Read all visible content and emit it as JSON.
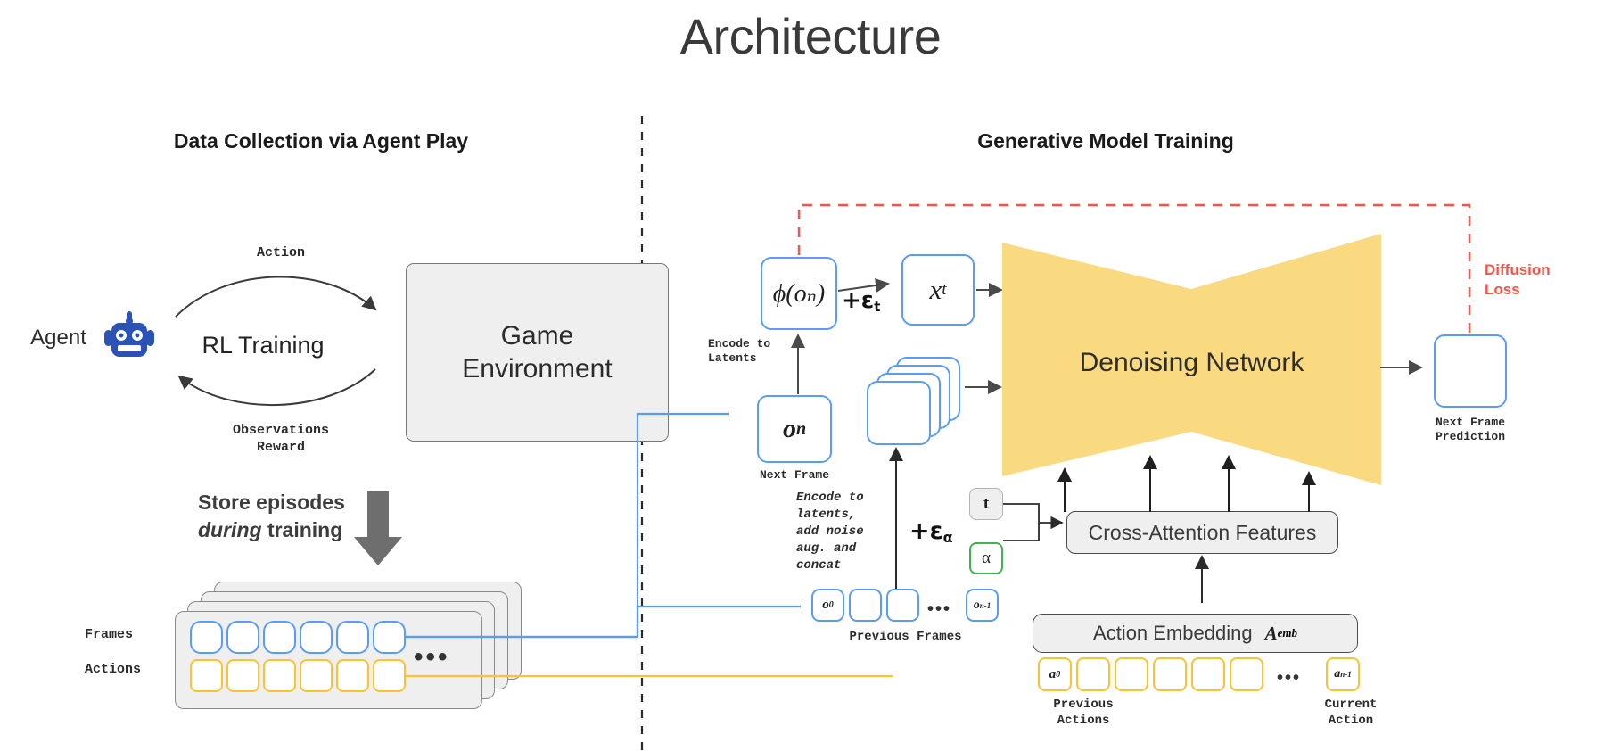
{
  "page": {
    "title": "Architecture",
    "accent_blue": "#5b9bf8",
    "accent_yellow": "#fcc230",
    "accent_red": "#f2564b",
    "network_fill": "#fada80",
    "robot_color": "#2a53b5"
  },
  "left_panel": {
    "heading": "Data Collection via Agent Play",
    "agent_label": "Agent",
    "robot_icon": "robot-icon",
    "rl_training_label": "RL Training",
    "action_label": "Action",
    "observations_reward_label": "Observations\nReward",
    "game_environment_label": "Game\nEnvironment",
    "store_episodes_line1": "Store episodes",
    "store_episodes_italic": "during",
    "store_episodes_line2": "training",
    "frames_label": "Frames",
    "actions_label": "Actions",
    "frames_count": 6,
    "actions_count": 6,
    "episode_card_count": 4,
    "ellipsis": "•••"
  },
  "right_panel": {
    "heading": "Generative Model Training",
    "phi_box_label": "ϕ(oₙ)",
    "noise_t_label": "+ε",
    "noise_t_sub": "t",
    "xt_box_label": "x",
    "xt_box_sub": "t",
    "encode_to_latents_label": "Encode to\nLatents",
    "next_frame_box_label": "o",
    "next_frame_box_sub": "n",
    "next_frame_caption": "Next Frame",
    "encode_concat_label": "Encode to\nlatents,\nadd noise\naug. and\nconcat",
    "noise_alpha_label": "+ε",
    "noise_alpha_sub": "α",
    "denoising_network_label": "Denoising Network",
    "diffusion_loss_label": "Diffusion\nLoss",
    "next_frame_prediction_caption": "Next Frame\nPrediction",
    "timestep_box_label": "t",
    "alpha_box_label": "α",
    "cross_attention_label": "Cross-Attention Features",
    "action_embedding_label": "Action Embedding",
    "action_embedding_symbol": "A",
    "action_embedding_symbol_sub": "emb",
    "previous_frames_caption": "Previous Frames",
    "previous_actions_caption": "Previous\nActions",
    "current_action_caption": "Current\nAction",
    "prev_frames": [
      {
        "label": "o",
        "sub": "0"
      },
      {
        "label": "",
        "sub": ""
      },
      {
        "label": "",
        "sub": ""
      }
    ],
    "prev_frames_last": {
      "label": "o",
      "sub": "n-1"
    },
    "prev_actions": [
      {
        "label": "a",
        "sub": "0"
      },
      {
        "label": "",
        "sub": ""
      },
      {
        "label": "",
        "sub": ""
      },
      {
        "label": "",
        "sub": ""
      },
      {
        "label": "",
        "sub": ""
      },
      {
        "label": "",
        "sub": ""
      }
    ],
    "current_action": {
      "label": "a",
      "sub": "n-1"
    },
    "latent_stack_count": 4,
    "ellipsis": "•••"
  }
}
